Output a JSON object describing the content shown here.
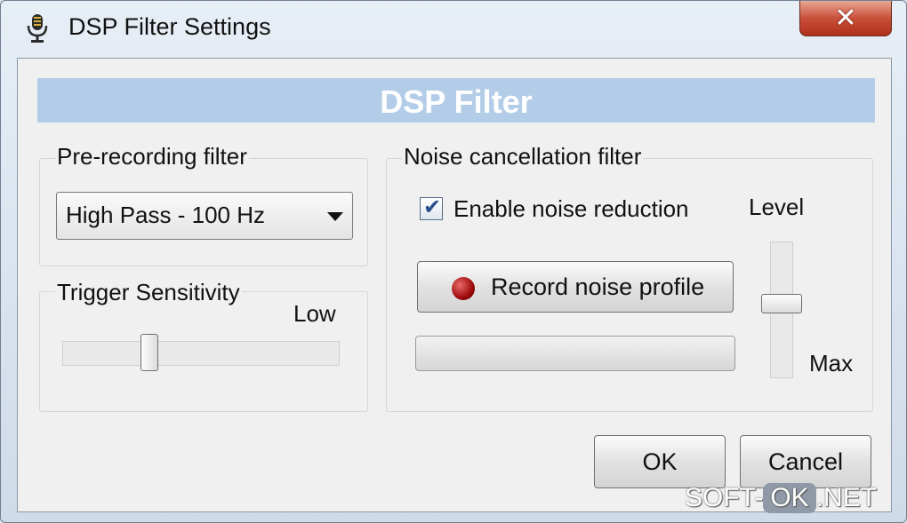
{
  "window": {
    "title": "DSP Filter Settings",
    "icon": "microphone-icon",
    "close_glyph": "✕"
  },
  "banner": {
    "text": "DSP Filter"
  },
  "pre_recording": {
    "group_label": "Pre-recording filter",
    "filter_value": "High Pass - 100 Hz"
  },
  "trigger": {
    "group_label": "Trigger Sensitivity",
    "low_label": "Low",
    "slider_value": 0.3
  },
  "noise": {
    "group_label": "Noise cancellation filter",
    "enable_label": "Enable noise reduction",
    "enable_checked": true,
    "record_button_label": "Record noise profile",
    "level_label": "Level",
    "max_label": "Max",
    "level_value": 0.55,
    "progress_value": 0
  },
  "buttons": {
    "ok": "OK",
    "cancel": "Cancel"
  },
  "watermark": {
    "left": "SOFT-",
    "mid": "OK",
    "right": ".NET"
  },
  "colors": {
    "banner_bg": "#b3cde8",
    "record_dot": "#9e0a0a",
    "close_button": "#c9503a"
  }
}
